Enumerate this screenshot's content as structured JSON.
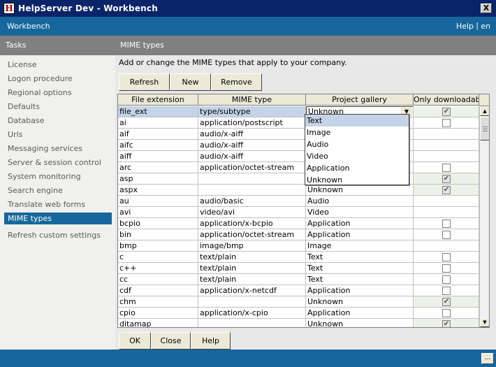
{
  "window": {
    "title": "HelpServer Dev - Workbench",
    "icon": "app-icon",
    "close_label": "X"
  },
  "workbench_bar": {
    "label": "Workbench",
    "help": "Help",
    "separator": "|",
    "lang": "en"
  },
  "sidebar": {
    "header": "Tasks",
    "items": [
      {
        "label": "License"
      },
      {
        "label": "Logon procedure"
      },
      {
        "label": "Regional options"
      },
      {
        "label": "Defaults"
      },
      {
        "label": "Database"
      },
      {
        "label": "Urls"
      },
      {
        "label": "Messaging services"
      },
      {
        "label": "Server & session control"
      },
      {
        "label": "System monitoring"
      },
      {
        "label": "Search engine"
      },
      {
        "label": "Translate web forms"
      },
      {
        "label": "MIME types",
        "active": true
      },
      {
        "label": "Refresh custom settings"
      }
    ]
  },
  "main": {
    "header": "MIME types",
    "description": "Add or change the MIME types that apply to your company.",
    "toolbar": {
      "refresh": "Refresh",
      "new": "New",
      "remove": "Remove"
    },
    "table": {
      "columns": [
        "File extension",
        "MIME type",
        "Project gallery",
        "Only downloadable"
      ],
      "rows": [
        {
          "ext": "file_ext",
          "mime": "type/subtype",
          "gallery": "Unknown",
          "dl": "checked-disabled",
          "selected": true
        },
        {
          "ext": "ai",
          "mime": "application/postscript",
          "gallery": "",
          "dl": "unchecked"
        },
        {
          "ext": "aif",
          "mime": "audio/x-aiff",
          "gallery": "",
          "dl": "none"
        },
        {
          "ext": "aifc",
          "mime": "audio/x-aiff",
          "gallery": "",
          "dl": "none"
        },
        {
          "ext": "aiff",
          "mime": "audio/x-aiff",
          "gallery": "",
          "dl": "none"
        },
        {
          "ext": "arc",
          "mime": "application/octet-stream",
          "gallery": "",
          "dl": "unchecked"
        },
        {
          "ext": "asp",
          "mime": "",
          "gallery": "",
          "dl": "checked-disabled"
        },
        {
          "ext": "aspx",
          "mime": "",
          "gallery": "Unknown",
          "dl": "checked-disabled"
        },
        {
          "ext": "au",
          "mime": "audio/basic",
          "gallery": "Audio",
          "dl": "none"
        },
        {
          "ext": "avi",
          "mime": "video/avi",
          "gallery": "Video",
          "dl": "none"
        },
        {
          "ext": "bcpio",
          "mime": "application/x-bcpio",
          "gallery": "Application",
          "dl": "unchecked"
        },
        {
          "ext": "bin",
          "mime": "application/octet-stream",
          "gallery": "Application",
          "dl": "unchecked"
        },
        {
          "ext": "bmp",
          "mime": "image/bmp",
          "gallery": "Image",
          "dl": "none"
        },
        {
          "ext": "c",
          "mime": "text/plain",
          "gallery": "Text",
          "dl": "unchecked"
        },
        {
          "ext": "c++",
          "mime": "text/plain",
          "gallery": "Text",
          "dl": "unchecked"
        },
        {
          "ext": "cc",
          "mime": "text/plain",
          "gallery": "Text",
          "dl": "unchecked"
        },
        {
          "ext": "cdf",
          "mime": "application/x-netcdf",
          "gallery": "Application",
          "dl": "unchecked"
        },
        {
          "ext": "chm",
          "mime": "",
          "gallery": "Unknown",
          "dl": "checked-disabled"
        },
        {
          "ext": "cpio",
          "mime": "application/x-cpio",
          "gallery": "Application",
          "dl": "unchecked"
        },
        {
          "ext": "ditamap",
          "mime": "",
          "gallery": "Unknown",
          "dl": "checked-disabled"
        }
      ]
    },
    "dropdown": {
      "options": [
        "Text",
        "Image",
        "Audio",
        "Video",
        "Application",
        "Unknown"
      ],
      "highlighted": "Text"
    },
    "footer": {
      "ok": "OK",
      "close": "Close",
      "help": "Help"
    }
  },
  "statusbar": {
    "button": "..."
  },
  "colors": {
    "titlebar": "#0a246a",
    "accent": "#17679c",
    "header_gray": "#808080",
    "selection": "#c5d3e8"
  }
}
